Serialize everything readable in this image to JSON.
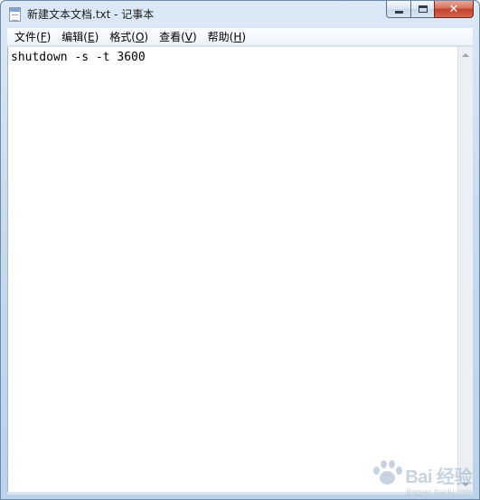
{
  "window": {
    "title": "新建文本文档.txt - 记事本",
    "icon": "notepad-icon",
    "caption_buttons": {
      "minimize": "minimize-icon",
      "maximize": "maximize-icon",
      "close": "close-icon",
      "close_glyph": "✕"
    }
  },
  "menu": [
    {
      "label": "文件(",
      "key": "F",
      "tail": ")"
    },
    {
      "label": "编辑(",
      "key": "E",
      "tail": ")"
    },
    {
      "label": "格式(",
      "key": "O",
      "tail": ")"
    },
    {
      "label": "查看(",
      "key": "V",
      "tail": ")"
    },
    {
      "label": "帮助(",
      "key": "H",
      "tail": ")"
    }
  ],
  "editor": {
    "content": "shutdown -s -t 3600"
  },
  "watermark": {
    "brand": "Bai  经验",
    "url": "jingyan.baidu.com"
  },
  "colors": {
    "frame": "#c9dcef",
    "close_button": "#c2412a",
    "editor_bg": "#ffffff"
  }
}
